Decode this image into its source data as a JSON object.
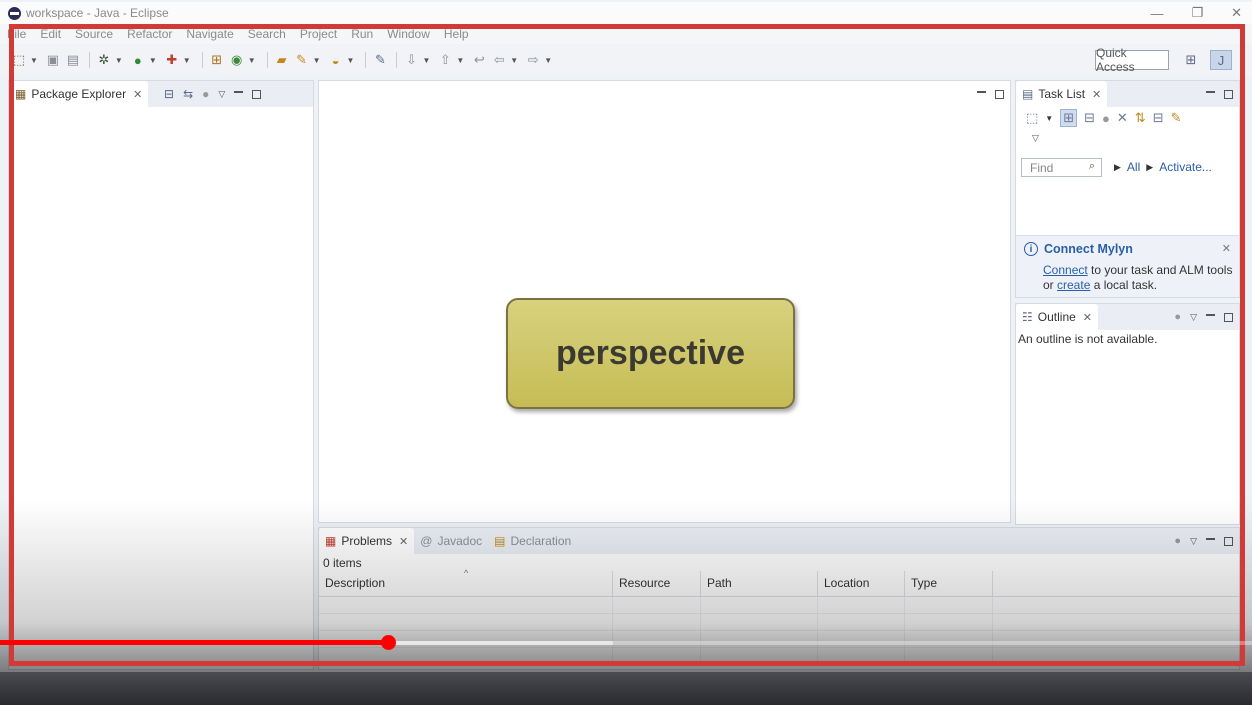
{
  "window": {
    "title": "workspace - Java - Eclipse",
    "controls": [
      "—",
      "❐",
      "✕"
    ]
  },
  "menu": [
    "File",
    "Edit",
    "Source",
    "Refactor",
    "Navigate",
    "Search",
    "Project",
    "Run",
    "Window",
    "Help"
  ],
  "toolbar": {
    "quick_access": "Quick Access",
    "icons": [
      "new-icon",
      "save-icon",
      "save-all-icon",
      "debug-icon",
      "run-icon",
      "external-tools-icon",
      "new-package-icon",
      "new-class-icon",
      "open-type-icon",
      "search-icon",
      "open-task-icon",
      "toggle-mark-icon",
      "next-annotation-icon",
      "prev-annotation-icon",
      "back-icon",
      "forward-icon"
    ]
  },
  "package_explorer": {
    "tab_label": "Package Explorer"
  },
  "task_list": {
    "tab_label": "Task List",
    "find_placeholder": "Find",
    "all_link": "All",
    "activate_link": "Activate..."
  },
  "mylyn": {
    "title": "Connect Mylyn",
    "connect_link": "Connect",
    "text1": " to your task and ALM tools",
    "text2_prefix": "or ",
    "create_link": "create",
    "text2_suffix": " a local task."
  },
  "outline": {
    "tab_label": "Outline",
    "message": "An outline is not available."
  },
  "bottom_tabs": {
    "problems": "Problems",
    "javadoc": "Javadoc",
    "declaration": "Declaration"
  },
  "problems": {
    "count": "0 items",
    "columns": [
      "Description",
      "Resource",
      "Path",
      "Location",
      "Type"
    ]
  },
  "callout": {
    "text": "perspective"
  },
  "video": {
    "played_fraction": 0.31,
    "buffered_fraction": 0.49
  },
  "colors": {
    "highlight": "#d23a37",
    "callout": "#cfc66a",
    "progress": "#ff0000"
  }
}
